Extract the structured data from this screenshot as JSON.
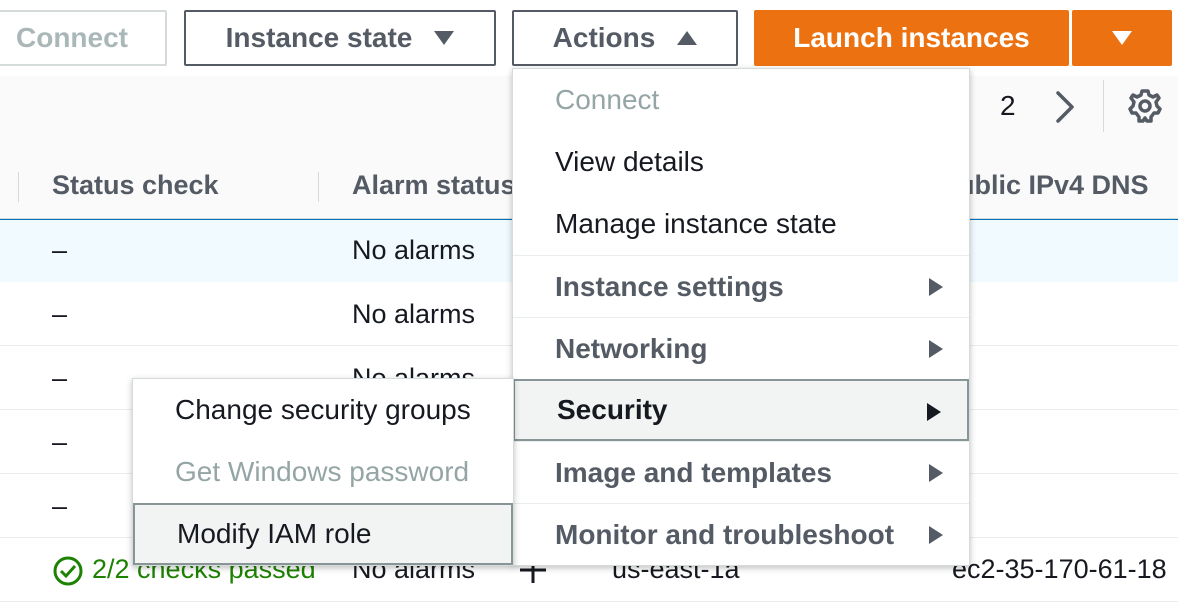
{
  "toolbar": {
    "connect": "Connect",
    "instance_state": "Instance state",
    "actions": "Actions",
    "launch": "Launch instances"
  },
  "pagination": {
    "current_page": "2"
  },
  "table": {
    "headers": [
      "Status check",
      "Alarm status",
      "ublic IPv4 DNS"
    ],
    "rows": [
      {
        "status": "–",
        "alarm": "No alarms"
      },
      {
        "status": "–",
        "alarm": "No alarms"
      },
      {
        "status": "–",
        "alarm": "No alarms"
      },
      {
        "status": "–",
        "alarm": ""
      },
      {
        "status": "–",
        "alarm": ""
      },
      {
        "status": "2/2 checks passed",
        "alarm": "No alarms",
        "az": "us-east-1a",
        "dns": "ec2-35-170-61-18"
      }
    ]
  },
  "actions_menu": {
    "items": [
      {
        "label": "Connect",
        "state": "disabled"
      },
      {
        "label": "View details",
        "state": "normal"
      },
      {
        "label": "Manage instance state",
        "state": "normal"
      },
      {
        "label": "Instance settings",
        "state": "group"
      },
      {
        "label": "Networking",
        "state": "group"
      },
      {
        "label": "Security",
        "state": "active"
      },
      {
        "label": "Image and templates",
        "state": "group"
      },
      {
        "label": "Monitor and troubleshoot",
        "state": "group"
      }
    ]
  },
  "security_submenu": {
    "items": [
      {
        "label": "Change security groups",
        "state": "normal"
      },
      {
        "label": "Get Windows password",
        "state": "disabled"
      },
      {
        "label": "Modify IAM role",
        "state": "active"
      }
    ]
  },
  "colors": {
    "primary": "#ec7211",
    "selected_row": "#f1faff",
    "selected_border": "#0073bb",
    "success": "#1d8102"
  }
}
